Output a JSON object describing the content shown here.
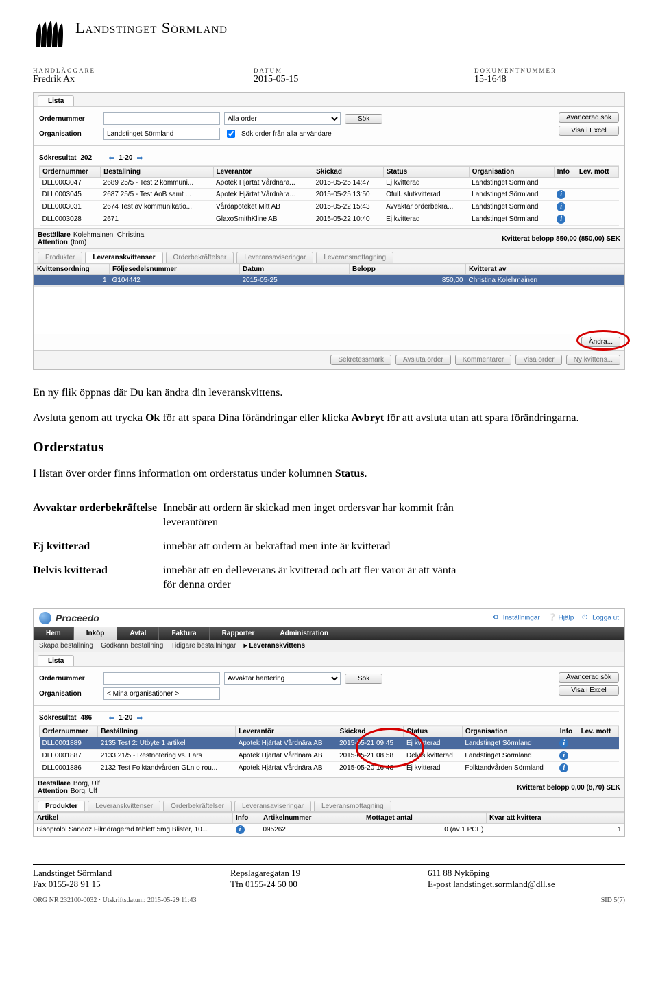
{
  "header": {
    "org": "Landstinget Sörmland",
    "handlaggare_label": "HANDLÄGGARE",
    "handlaggare": "Fredrik Ax",
    "datum_label": "DATUM",
    "datum": "2015-05-15",
    "doknr_label": "DOKUMENTNUMMER",
    "doknr": "15-1648"
  },
  "shot1": {
    "tab_lista": "Lista",
    "lbl_ordernr": "Ordernummer",
    "lbl_org": "Organisation",
    "org_value": "Landstinget Sörmland",
    "filter_value": "Alla order",
    "chk_label": "Sök order från alla användare",
    "btn_sok": "Sök",
    "btn_adv": "Avancerad sök",
    "btn_excel": "Visa i Excel",
    "res_label": "Sökresultat",
    "res_count": "202",
    "res_range": "1-20",
    "cols": [
      "Ordernummer",
      "Beställning",
      "Leverantör",
      "Skickad",
      "Status",
      "Organisation",
      "Info",
      "Lev. mott"
    ],
    "rows": [
      {
        "nr": "DLL0003047",
        "best": "2689 25/5 - Test 2 kommuni...",
        "lev": "Apotek Hjärtat Vårdnära...",
        "skick": "2015-05-25 14:47",
        "status": "Ej kvitterad",
        "org": "Landstinget Sörmland",
        "info": false
      },
      {
        "nr": "DLL0003045",
        "best": "2687 25/5 - Test AoB samt ...",
        "lev": "Apotek Hjärtat Vårdnära...",
        "skick": "2015-05-25 13:50",
        "status": "Ofull. slutkvitterad",
        "org": "Landstinget Sörmland",
        "info": true
      },
      {
        "nr": "DLL0003031",
        "best": "2674 Test av kommunikatio...",
        "lev": "Vårdapoteket Mitt AB",
        "skick": "2015-05-22 15:43",
        "status": "Avvaktar orderbekrä...",
        "org": "Landstinget Sörmland",
        "info": true
      },
      {
        "nr": "DLL0003028",
        "best": "2671",
        "lev": "GlaxoSmithKline AB",
        "skick": "2015-05-22 10:40",
        "status": "Ej kvitterad",
        "org": "Landstinget Sörmland",
        "info": true
      }
    ],
    "best_label": "Beställare",
    "best_name": "Kolehmainen, Christina",
    "att_label": "Attention",
    "att_val": "(tom)",
    "kvbel_label": "Kvitterat belopp",
    "kvbel_val": "850,00 (850,00) SEK",
    "subtabs": [
      "Produkter",
      "Leveranskvittenser",
      "Orderbekräftelser",
      "Leveransaviseringar",
      "Leveransmottagning"
    ],
    "kv_cols": [
      "Kvittensordning",
      "Följesedelsnummer",
      "Datum",
      "Belopp",
      "Kvitterat av"
    ],
    "kv_row": {
      "ord": "1",
      "fs": "G104442",
      "datum": "2015-05-25",
      "bel": "850,00",
      "av": "Christina Kolehmainen"
    },
    "btn_andra": "Ändra...",
    "btn_sekr": "Sekretessmärk",
    "btn_avsluta": "Avsluta order",
    "btn_komm": "Kommentarer",
    "btn_visa": "Visa order",
    "btn_nykv": "Ny kvittens..."
  },
  "prose": {
    "p1a": "En ny flik öppnas där Du kan ändra din leveranskvittens.",
    "p2a": "Avsluta genom att trycka ",
    "p2b": "Ok",
    "p2c": " för att spara Dina förändringar eller klicka ",
    "p2d": "Avbryt",
    "p2e": " för att avsluta utan att spara förändringarna.",
    "h_orderstatus": "Orderstatus",
    "p3a": "I listan över order finns information om orderstatus under kolumnen ",
    "p3b": "Status",
    "p3c": ".",
    "defs": [
      {
        "k": "Avvaktar orderbekräftelse",
        "v": "Innebär att ordern är skickad men inget ordersvar har kommit från leverantören"
      },
      {
        "k": "Ej kvitterad",
        "v": "innebär att ordern är bekräftad men inte är kvitterad"
      },
      {
        "k": "Delvis kvitterad",
        "v": "innebär att en delleverans är kvitterad och att fler varor är att vänta för denna order"
      }
    ]
  },
  "shot2": {
    "brand": "Proceedo",
    "top_install": "Inställningar",
    "top_help": "Hjälp",
    "top_logout": "Logga ut",
    "nav": [
      "Hem",
      "Inköp",
      "Avtal",
      "Faktura",
      "Rapporter",
      "Administration"
    ],
    "crumbs": [
      "Skapa beställning",
      "Godkänn beställning",
      "Tidigare beställningar",
      "▸ Leveranskvittens"
    ],
    "tab_lista": "Lista",
    "lbl_ordernr": "Ordernummer",
    "lbl_org": "Organisation",
    "org_value": "< Mina organisationer >",
    "filter_value": "Avvaktar hantering",
    "btn_sok": "Sök",
    "btn_adv": "Avancerad sök",
    "btn_excel": "Visa i Excel",
    "res_label": "Sökresultat",
    "res_count": "486",
    "res_range": "1-20",
    "cols": [
      "Ordernummer",
      "Beställning",
      "Leverantör",
      "Skickad",
      "Status",
      "Organisation",
      "Info",
      "Lev. mott"
    ],
    "rows": [
      {
        "nr": "DLL0001889",
        "best": "2135 Test 2: Utbyte 1 artikel",
        "lev": "Apotek Hjärtat Vårdnära AB",
        "skick": "2015-05-21 09:45",
        "status": "Ej kvitterad",
        "org": "Landstinget Sörmland",
        "info": true,
        "sel": true
      },
      {
        "nr": "DLL0001887",
        "best": "2133 21/5 - Restnotering vs. Lars",
        "lev": "Apotek Hjärtat Vårdnära AB",
        "skick": "2015-05-21 08:58",
        "status": "Delvis kvitterad",
        "org": "Landstinget Sörmland",
        "info": true
      },
      {
        "nr": "DLL0001886",
        "best": "2132 Test Folktandvården GLn o rou...",
        "lev": "Apotek Hjärtat Vårdnära AB",
        "skick": "2015-05-20 16:48",
        "status": "Ej kvitterad",
        "org": "Folktandvården Sörmland",
        "info": true
      }
    ],
    "best_label": "Beställare",
    "best_name": "Borg, Ulf",
    "att_label": "Attention",
    "att_val": "Borg, Ulf",
    "kvbel_label": "Kvitterat belopp",
    "kvbel_val": "0,00 (8,70) SEK",
    "subtabs": [
      "Produkter",
      "Leveranskvittenser",
      "Orderbekräftelser",
      "Leveransaviseringar",
      "Leveransmottagning"
    ],
    "prod_cols": [
      "Artikel",
      "Info",
      "Artikelnummer",
      "Mottaget antal",
      "Kvar att kvittera"
    ],
    "prod_row": {
      "art": "Bisoprolol Sandoz Filmdragerad tablett 5mg Blister, 10...",
      "info": true,
      "artnr": "095262",
      "mott": "0 (av 1 PCE)",
      "kvar": "1"
    }
  },
  "footer": {
    "c1a": "Landstinget Sörmland",
    "c1b": "Fax 0155-28 91 15",
    "c2a": "Repslagaregatan 19",
    "c2b": "Tfn 0155-24 50 00",
    "c3a": "611 88 Nyköping",
    "c3b": "E-post landstinget.sormland@dll.se",
    "orgnr": "ORG NR 232100-0032 · Utskriftsdatum: 2015-05-29 11:43",
    "sid": "SID 5(7)"
  }
}
